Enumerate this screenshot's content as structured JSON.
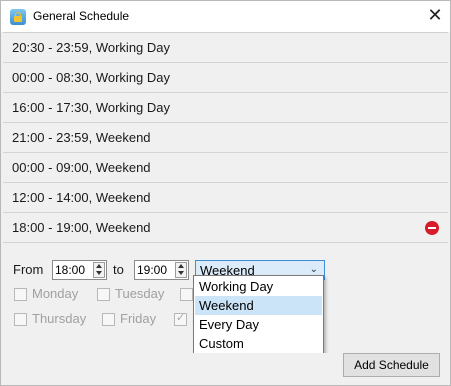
{
  "window": {
    "title": "General Schedule",
    "app_icon": "lock-icon",
    "close_glyph": "✕"
  },
  "schedules": [
    {
      "label": "20:30 - 23:59, Working Day"
    },
    {
      "label": "00:00 - 08:30, Working Day"
    },
    {
      "label": "16:00 - 17:30, Working Day"
    },
    {
      "label": "21:00 - 23:59, Weekend"
    },
    {
      "label": "00:00 - 09:00, Weekend"
    },
    {
      "label": "12:00 - 14:00, Weekend"
    },
    {
      "label": "18:00 - 19:00, Weekend"
    }
  ],
  "editor": {
    "from_label": "From",
    "from_value": "18:00",
    "to_label": "to",
    "to_value": "19:00",
    "type_value": "Weekend",
    "days": [
      {
        "label": "Monday",
        "checked": false
      },
      {
        "label": "Tuesday",
        "checked": false
      },
      {
        "label": "Thursday",
        "checked": false
      },
      {
        "label": "Friday",
        "checked": false
      },
      {
        "label": "S",
        "checked": true
      }
    ]
  },
  "dropdown": {
    "options": [
      "Working Day",
      "Weekend",
      "Every Day",
      "Custom"
    ],
    "selected": "Weekend"
  },
  "footer": {
    "add_label": "Add Schedule"
  },
  "colors": {
    "remove": "#d61e2a",
    "select_highlight": "#cce4f7",
    "select_border": "#3b8fd4"
  }
}
